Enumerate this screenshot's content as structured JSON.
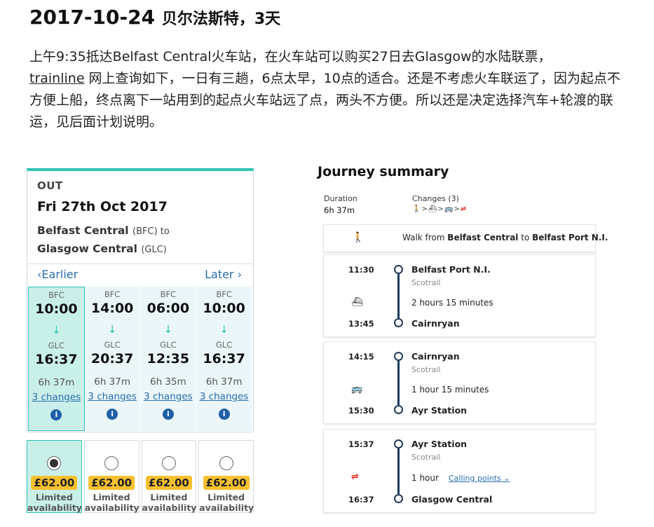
{
  "heading": {
    "date": "2017-10-24",
    "rest": "贝尔法斯特，3天"
  },
  "paragraph": {
    "part1": "上午9:35抵达Belfast Central火车站，在火车站可以购买27日去Glasgow的水陆联票，",
    "link": "trainline",
    "part2": " 网上查询如下，一日有三趟，6点太早，10点的适合。还是不考虑火车联运了，因为起点不方便上船，终点离下一站用到的起点火车站远了点，两头不方便。所以还是决定选择汽车+轮渡的联运，见后面计划说明。"
  },
  "trainline": {
    "accent": "#2ec4b6",
    "out_label": "OUT",
    "date": "Fri 27th Oct 2017",
    "from_name": "Belfast Central",
    "from_code": "(BFC) to",
    "to_name": "Glasgow Central",
    "to_code": "(GLC)",
    "earlier": "Earlier",
    "later": "Later",
    "journeys": [
      {
        "from": "BFC",
        "dep": "10:00",
        "to": "GLC",
        "arr": "16:37",
        "duration": "6h 37m",
        "changes": "3 changes",
        "price": "£62.00",
        "avail1": "Limited",
        "avail2": "availability"
      },
      {
        "from": "BFC",
        "dep": "14:00",
        "to": "GLC",
        "arr": "20:37",
        "duration": "6h 37m",
        "changes": "3 changes",
        "price": "£62.00",
        "avail1": "Limited",
        "avail2": "availability"
      },
      {
        "from": "BFC",
        "dep": "06:00",
        "to": "GLC",
        "arr": "12:35",
        "duration": "6h 35m",
        "changes": "3 changes",
        "price": "£62.00",
        "avail1": "Limited",
        "avail2": "availability"
      },
      {
        "from": "BFC",
        "dep": "10:00",
        "to": "GLC",
        "arr": "16:37",
        "duration": "6h 37m",
        "changes": "3 changes",
        "price": "£62.00",
        "avail1": "Limited",
        "avail2": "availability"
      }
    ]
  },
  "summary": {
    "title": "Journey summary",
    "duration_label": "Duration",
    "duration": "6h 37m",
    "changes_label": "Changes (3)",
    "walk_prefix": "Walk from ",
    "walk_from": "Belfast Central",
    "walk_mid": " to ",
    "walk_to": "Belfast Port N.I.",
    "calling_points": "Calling points",
    "legs": [
      {
        "dep_time": "11:30",
        "dep_station": "Belfast Port N.I.",
        "operator": "Scotrail",
        "duration": "2 hours 15 minutes",
        "arr_time": "13:45",
        "arr_station": "Cairnryan",
        "mode_icon": "ferry-icon"
      },
      {
        "dep_time": "14:15",
        "dep_station": "Cairnryan",
        "operator": "Scotrail",
        "duration": "1 hour 15 minutes",
        "arr_time": "15:30",
        "arr_station": "Ayr Station",
        "mode_icon": "bus-icon"
      },
      {
        "dep_time": "15:37",
        "dep_station": "Ayr Station",
        "operator": "Scotrail",
        "duration": "1 hour",
        "arr_time": "16:37",
        "arr_station": "Glasgow Central",
        "mode_icon": "national-rail-icon"
      }
    ]
  }
}
